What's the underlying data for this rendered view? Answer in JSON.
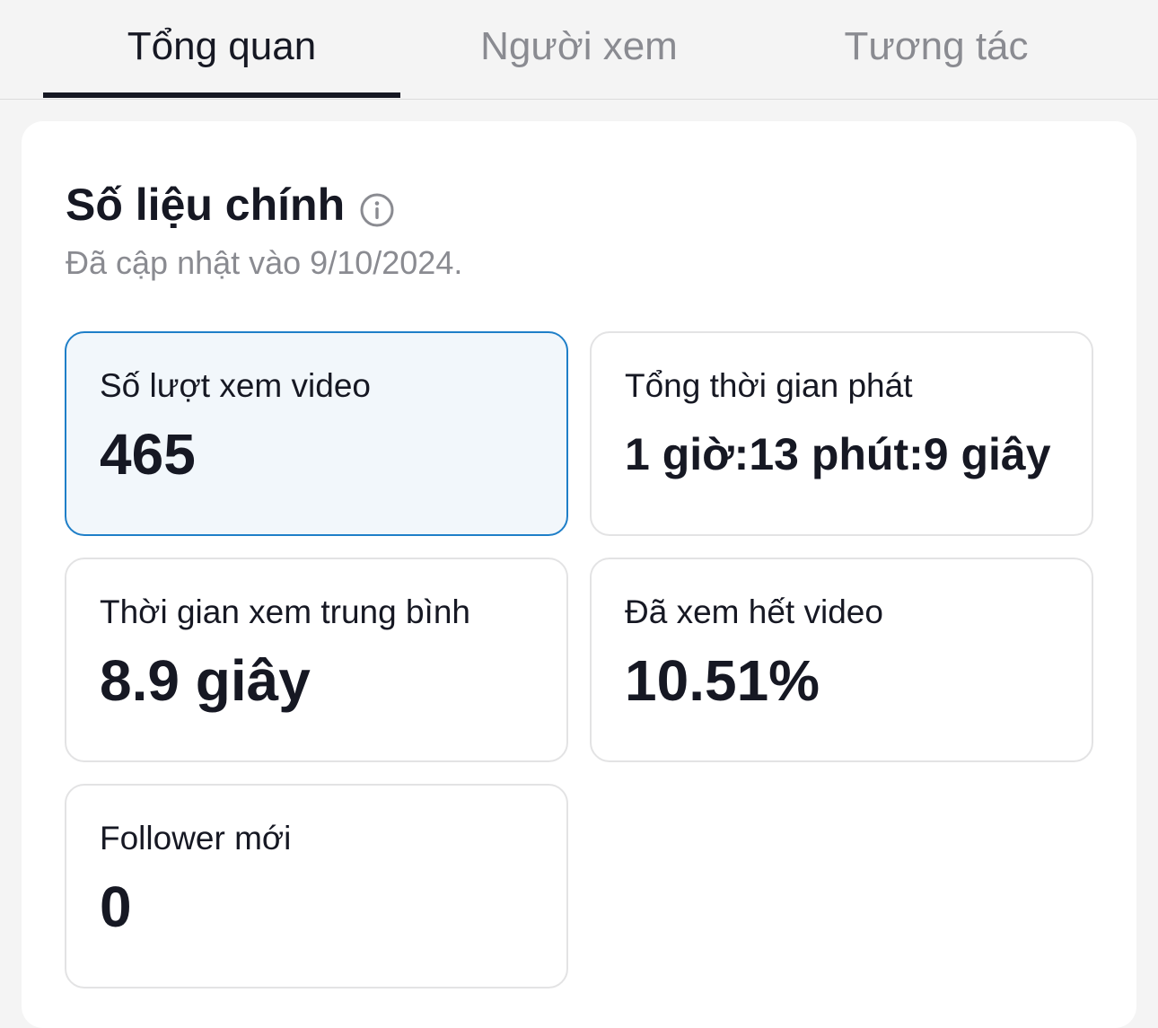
{
  "tabs": [
    {
      "label": "Tổng quan",
      "active": true
    },
    {
      "label": "Người xem",
      "active": false
    },
    {
      "label": "Tương tác",
      "active": false
    }
  ],
  "section": {
    "title": "Số liệu chính",
    "info_icon": "info-icon",
    "updated": "Đã cập nhật vào 9/10/2024."
  },
  "metrics": [
    {
      "label": "Số lượt xem video",
      "value": "465",
      "selected": true
    },
    {
      "label": "Tổng thời gian phát",
      "value": "1 giờ:13 phút:9 giây",
      "selected": false
    },
    {
      "label": "Thời gian xem trung bình",
      "value": "8.9 giây",
      "selected": false
    },
    {
      "label": "Đã xem hết video",
      "value": "10.51%",
      "selected": false
    },
    {
      "label": "Follower mới",
      "value": "0",
      "selected": false
    }
  ],
  "colors": {
    "accent": "#1f7fc8",
    "selected_bg": "#f2f7fb",
    "text": "#161823",
    "muted": "#8a8b91",
    "background": "#f4f4f4"
  }
}
